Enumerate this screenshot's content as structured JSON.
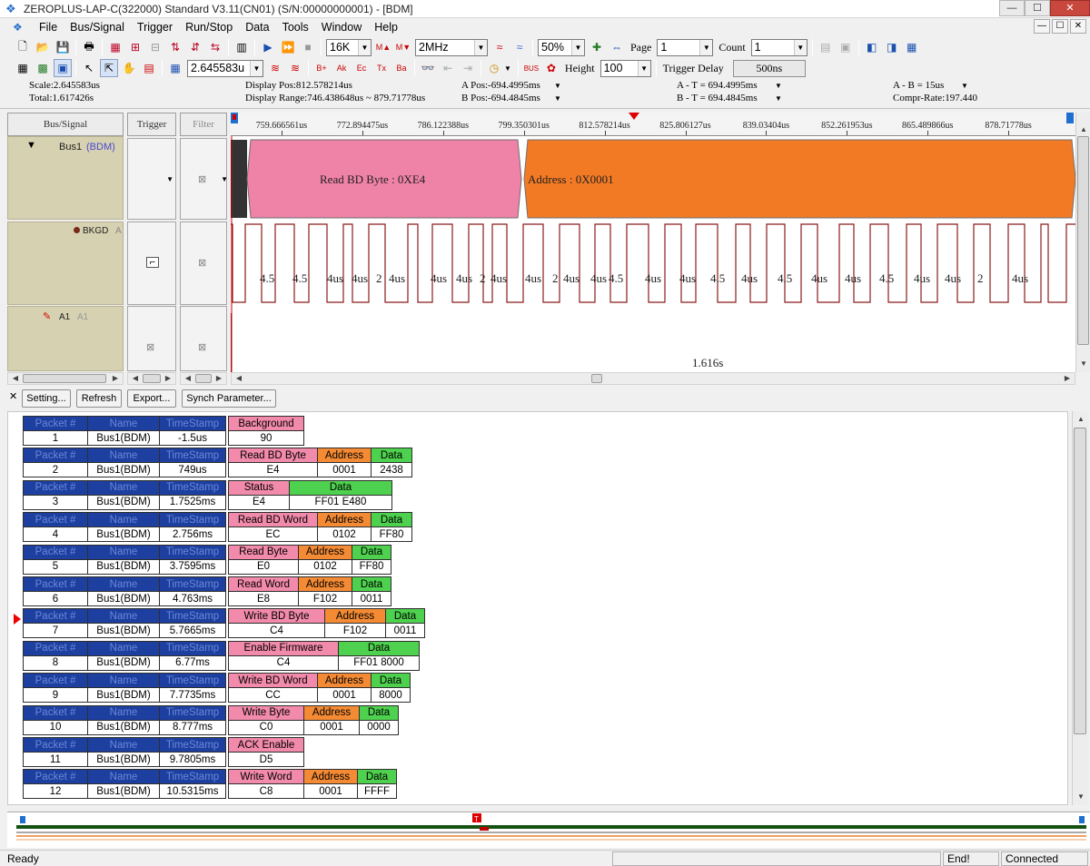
{
  "window": {
    "title": "ZEROPLUS-LAP-C(322000) Standard V3.11(CN01) (S/N:00000000001) - [BDM]",
    "minimize": "—",
    "maximize": "☐",
    "close": "✕"
  },
  "menu": [
    "File",
    "Bus/Signal",
    "Trigger",
    "Run/Stop",
    "Data",
    "Tools",
    "Window",
    "Help"
  ],
  "toolbar1": {
    "memory": "16K",
    "frequency": "2MHz",
    "zoom": "50%",
    "page_label": "Page",
    "page_value": "1",
    "count_label": "Count",
    "count_value": "1"
  },
  "toolbar2": {
    "scale_value": "2.645583u",
    "height_label": "Height",
    "height_value": "100",
    "trigger_delay_label": "Trigger Delay",
    "trigger_delay_value": "500ns"
  },
  "info": {
    "scale": "Scale:2.645583us",
    "total": "Total:1.617426s",
    "display_pos": "Display Pos:812.578214us",
    "display_range": "Display Range:746.438648us ~ 879.71778us",
    "a_pos": "A Pos:-694.4995ms",
    "b_pos": "B Pos:-694.4845ms",
    "a_t": "A - T = 694.4995ms",
    "b_t": "B - T = 694.4845ms",
    "a_b": "A - B = 15us",
    "compr_rate": "Compr-Rate:197.440"
  },
  "columns": {
    "bus_signal": "Bus/Signal",
    "trigger": "Trigger",
    "filter": "Filter"
  },
  "ruler": [
    "759.666561us",
    "772.894475us",
    "786.122388us",
    "799.350301us",
    "812.578214us",
    "825.806127us",
    "839.03404us",
    "852.261953us",
    "865.489866us",
    "878.71778us"
  ],
  "signals": [
    {
      "name": "Bus1",
      "tag": "(BDM)"
    },
    {
      "name": "BKGD",
      "tag": "A"
    },
    {
      "name": "A1",
      "tag": "A1"
    }
  ],
  "bus_segments": [
    {
      "label": "Read BD Byte : 0XE4",
      "color": "#ef82a7"
    },
    {
      "label": "Address : 0X0001",
      "color": "#f37a24"
    }
  ],
  "bkgd_labels": [
    "4.5",
    "4.5",
    "4us",
    "4us",
    "2",
    "4us",
    "4us",
    "4us",
    "2",
    "4us",
    "4us",
    "2",
    "4us",
    "4us",
    "4.5",
    "4us",
    "4us",
    "4.5",
    "4us",
    "4.5",
    "4us",
    "4us",
    "4.5",
    "4us",
    "4us",
    "2",
    "4us"
  ],
  "a1_label": "1.616s",
  "buttons": {
    "setting": "Setting...",
    "refresh": "Refresh",
    "export": "Export...",
    "synch": "Synch Parameter..."
  },
  "packets": [
    {
      "no": "1",
      "name": "Bus1(BDM)",
      "ts": "-1.5us",
      "fields": [
        {
          "h": "Background",
          "v": "90",
          "c": "pink"
        }
      ]
    },
    {
      "no": "2",
      "name": "Bus1(BDM)",
      "ts": "749us",
      "fields": [
        {
          "h": "Read BD Byte",
          "v": "E4",
          "c": "pink"
        },
        {
          "h": "Address",
          "v": "0001",
          "c": "orange"
        },
        {
          "h": "Data",
          "v": "2438",
          "c": "green"
        }
      ]
    },
    {
      "no": "3",
      "name": "Bus1(BDM)",
      "ts": "1.7525ms",
      "fields": [
        {
          "h": "Status",
          "v": "E4",
          "c": "pink"
        },
        {
          "h": "Data",
          "v": "FF01     E480",
          "c": "green"
        }
      ]
    },
    {
      "no": "4",
      "name": "Bus1(BDM)",
      "ts": "2.756ms",
      "fields": [
        {
          "h": "Read BD Word",
          "v": "EC",
          "c": "pink"
        },
        {
          "h": "Address",
          "v": "0102",
          "c": "orange"
        },
        {
          "h": "Data",
          "v": "FF80",
          "c": "green"
        }
      ]
    },
    {
      "no": "5",
      "name": "Bus1(BDM)",
      "ts": "3.7595ms",
      "fields": [
        {
          "h": "Read Byte",
          "v": "E0",
          "c": "pink"
        },
        {
          "h": "Address",
          "v": "0102",
          "c": "orange"
        },
        {
          "h": "Data",
          "v": "FF80",
          "c": "green"
        }
      ]
    },
    {
      "no": "6",
      "name": "Bus1(BDM)",
      "ts": "4.763ms",
      "fields": [
        {
          "h": "Read Word",
          "v": "E8",
          "c": "pink"
        },
        {
          "h": "Address",
          "v": "F102",
          "c": "orange"
        },
        {
          "h": "Data",
          "v": "0011",
          "c": "green"
        }
      ]
    },
    {
      "no": "7",
      "name": "Bus1(BDM)",
      "ts": "5.7665ms",
      "fields": [
        {
          "h": "Write BD Byte",
          "v": "C4",
          "c": "pink"
        },
        {
          "h": "Address",
          "v": "F102",
          "c": "orange"
        },
        {
          "h": "Data",
          "v": "0011",
          "c": "green"
        }
      ]
    },
    {
      "no": "8",
      "name": "Bus1(BDM)",
      "ts": "6.77ms",
      "fields": [
        {
          "h": "Enable Firmware",
          "v": "C4",
          "c": "pink"
        },
        {
          "h": "Data",
          "v": "FF01     8000",
          "c": "green"
        }
      ]
    },
    {
      "no": "9",
      "name": "Bus1(BDM)",
      "ts": "7.7735ms",
      "fields": [
        {
          "h": "Write BD Word",
          "v": "CC",
          "c": "pink"
        },
        {
          "h": "Address",
          "v": "0001",
          "c": "orange"
        },
        {
          "h": "Data",
          "v": "8000",
          "c": "green"
        }
      ]
    },
    {
      "no": "10",
      "name": "Bus1(BDM)",
      "ts": "8.777ms",
      "fields": [
        {
          "h": "Write Byte",
          "v": "C0",
          "c": "pink"
        },
        {
          "h": "Address",
          "v": "0001",
          "c": "orange"
        },
        {
          "h": "Data",
          "v": "0000",
          "c": "green"
        }
      ]
    },
    {
      "no": "11",
      "name": "Bus1(BDM)",
      "ts": "9.7805ms",
      "fields": [
        {
          "h": "ACK Enable",
          "v": "D5",
          "c": "pink"
        }
      ]
    },
    {
      "no": "12",
      "name": "Bus1(BDM)",
      "ts": "10.5315ms",
      "fields": [
        {
          "h": "Write Word",
          "v": "C8",
          "c": "pink"
        },
        {
          "h": "Address",
          "v": "0001",
          "c": "orange"
        },
        {
          "h": "Data",
          "v": "FFFF",
          "c": "green"
        }
      ]
    }
  ],
  "packet_headers": {
    "no": "Packet #",
    "name": "Name",
    "ts": "TimeStamp"
  },
  "status": {
    "ready": "Ready",
    "end": "End!",
    "connected": "Connected"
  },
  "icons": {
    "cursor_a": "A",
    "cursor_b": "B",
    "trigger": "T"
  }
}
